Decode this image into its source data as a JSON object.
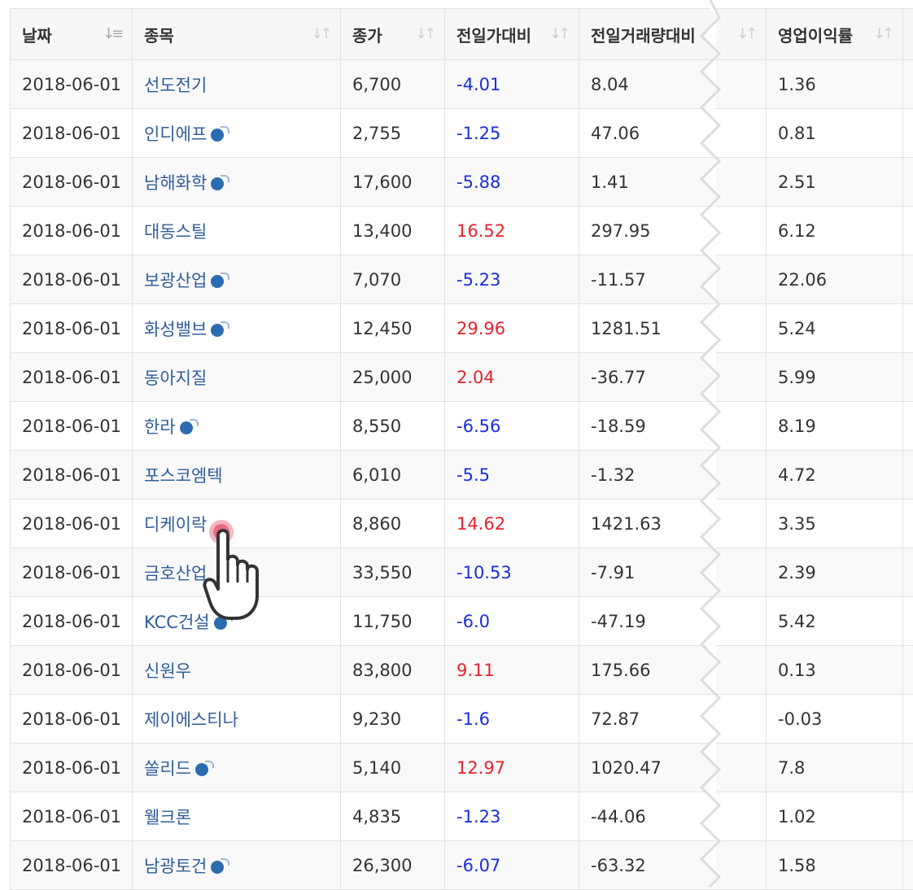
{
  "table": {
    "columns": [
      "날짜",
      "종목",
      "종가",
      "전일가대비",
      "전일거래량대비",
      "영업이익률"
    ],
    "rows": [
      {
        "date": "2018-06-01",
        "name": "선도전기",
        "icon": "",
        "close": "6,700",
        "price_change": "-4.01",
        "volume_change": "8.04",
        "op_margin": "1.36"
      },
      {
        "date": "2018-06-01",
        "name": "인디에프",
        "icon": "bomb-icon",
        "close": "2,755",
        "price_change": "-1.25",
        "volume_change": "47.06",
        "op_margin": "0.81"
      },
      {
        "date": "2018-06-01",
        "name": "남해화학",
        "icon": "bomb-icon",
        "close": "17,600",
        "price_change": "-5.88",
        "volume_change": "1.41",
        "op_margin": "2.51"
      },
      {
        "date": "2018-06-01",
        "name": "대동스틸",
        "icon": "",
        "close": "13,400",
        "price_change": "16.52",
        "volume_change": "297.95",
        "op_margin": "6.12"
      },
      {
        "date": "2018-06-01",
        "name": "보광산업",
        "icon": "bomb-icon",
        "close": "7,070",
        "price_change": "-5.23",
        "volume_change": "-11.57",
        "op_margin": "22.06"
      },
      {
        "date": "2018-06-01",
        "name": "화성밸브",
        "icon": "bomb-icon",
        "close": "12,450",
        "price_change": "29.96",
        "volume_change": "1281.51",
        "op_margin": "5.24"
      },
      {
        "date": "2018-06-01",
        "name": "동아지질",
        "icon": "",
        "close": "25,000",
        "price_change": "2.04",
        "volume_change": "-36.77",
        "op_margin": "5.99"
      },
      {
        "date": "2018-06-01",
        "name": "한라",
        "icon": "bomb-icon",
        "close": "8,550",
        "price_change": "-6.56",
        "volume_change": "-18.59",
        "op_margin": "8.19"
      },
      {
        "date": "2018-06-01",
        "name": "포스코엠텍",
        "icon": "",
        "close": "6,010",
        "price_change": "-5.5",
        "volume_change": "-1.32",
        "op_margin": "4.72"
      },
      {
        "date": "2018-06-01",
        "name": "디케이락",
        "icon": "",
        "close": "8,860",
        "price_change": "14.62",
        "volume_change": "1421.63",
        "op_margin": "3.35"
      },
      {
        "date": "2018-06-01",
        "name": "금호산업",
        "icon": "",
        "close": "33,550",
        "price_change": "-10.53",
        "volume_change": "-7.91",
        "op_margin": "2.39"
      },
      {
        "date": "2018-06-01",
        "name": "KCC건설",
        "icon": "bomb-icon",
        "close": "11,750",
        "price_change": "-6.0",
        "volume_change": "-47.19",
        "op_margin": "5.42"
      },
      {
        "date": "2018-06-01",
        "name": "신원우",
        "icon": "",
        "close": "83,800",
        "price_change": "9.11",
        "volume_change": "175.66",
        "op_margin": "0.13"
      },
      {
        "date": "2018-06-01",
        "name": "제이에스티나",
        "icon": "",
        "close": "9,230",
        "price_change": "-1.6",
        "volume_change": "72.87",
        "op_margin": "-0.03"
      },
      {
        "date": "2018-06-01",
        "name": "쏠리드",
        "icon": "bomb-icon",
        "close": "5,140",
        "price_change": "12.97",
        "volume_change": "1020.47",
        "op_margin": "7.8"
      },
      {
        "date": "2018-06-01",
        "name": "웰크론",
        "icon": "",
        "close": "4,835",
        "price_change": "-1.23",
        "volume_change": "-44.06",
        "op_margin": "1.02"
      },
      {
        "date": "2018-06-01",
        "name": "남광토건",
        "icon": "bomb-icon",
        "close": "26,300",
        "price_change": "-6.07",
        "volume_change": "-63.32",
        "op_margin": "1.58"
      }
    ]
  },
  "colors": {
    "negative": "#1b2ce0",
    "positive": "#e5232e",
    "link": "#2f5d9a",
    "icon": "#2b6cb0"
  },
  "cursor": {
    "icon": "hand-pointer-icon"
  }
}
